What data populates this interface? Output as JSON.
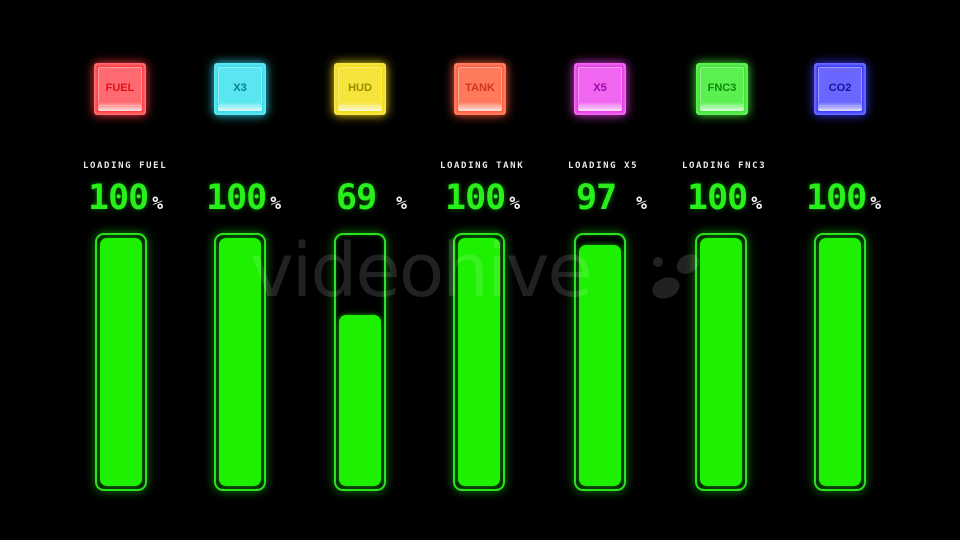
{
  "buttons": [
    {
      "label": "FUEL",
      "color": "#ff3a3e",
      "face": "#ff6a70",
      "text": "#e0101c"
    },
    {
      "label": "X3",
      "color": "#33dcec",
      "face": "#5ae6f0",
      "text": "#0a7d8a"
    },
    {
      "label": "HUD",
      "color": "#f3dc10",
      "face": "#f6e43a",
      "text": "#9a8a00"
    },
    {
      "label": "TANK",
      "color": "#ff5a3a",
      "face": "#ff7a5a",
      "text": "#d2341a"
    },
    {
      "label": "X5",
      "color": "#e63ae6",
      "face": "#f066f0",
      "text": "#9c0aa8"
    },
    {
      "label": "FNC3",
      "color": "#3ae631",
      "face": "#5af050",
      "text": "#0d8a0c"
    },
    {
      "label": "CO2",
      "color": "#3a3aff",
      "face": "#6a66ff",
      "text": "#101898"
    }
  ],
  "channels": [
    {
      "caption": "LOADING FUEL",
      "value": "100",
      "unit": "%",
      "fill": 1.0
    },
    {
      "caption": "",
      "value": "100",
      "unit": "%",
      "fill": 1.0
    },
    {
      "caption": "",
      "value": "69",
      "unit": "%",
      "fill": 0.69
    },
    {
      "caption": "LOADING TANK",
      "value": "100",
      "unit": "%",
      "fill": 1.0
    },
    {
      "caption": "LOADING X5",
      "value": "97",
      "unit": "%",
      "fill": 0.97
    },
    {
      "caption": "LOADING FNC3",
      "value": "100",
      "unit": "%",
      "fill": 1.0
    },
    {
      "caption": "",
      "value": "100",
      "unit": "%",
      "fill": 1.0
    }
  ],
  "watermark": {
    "text": "videohive",
    "icon": "videohive-logo-icon"
  },
  "colors": {
    "accent_green": "#1df000",
    "frame_green": "#29e31e",
    "background": "#000000"
  }
}
